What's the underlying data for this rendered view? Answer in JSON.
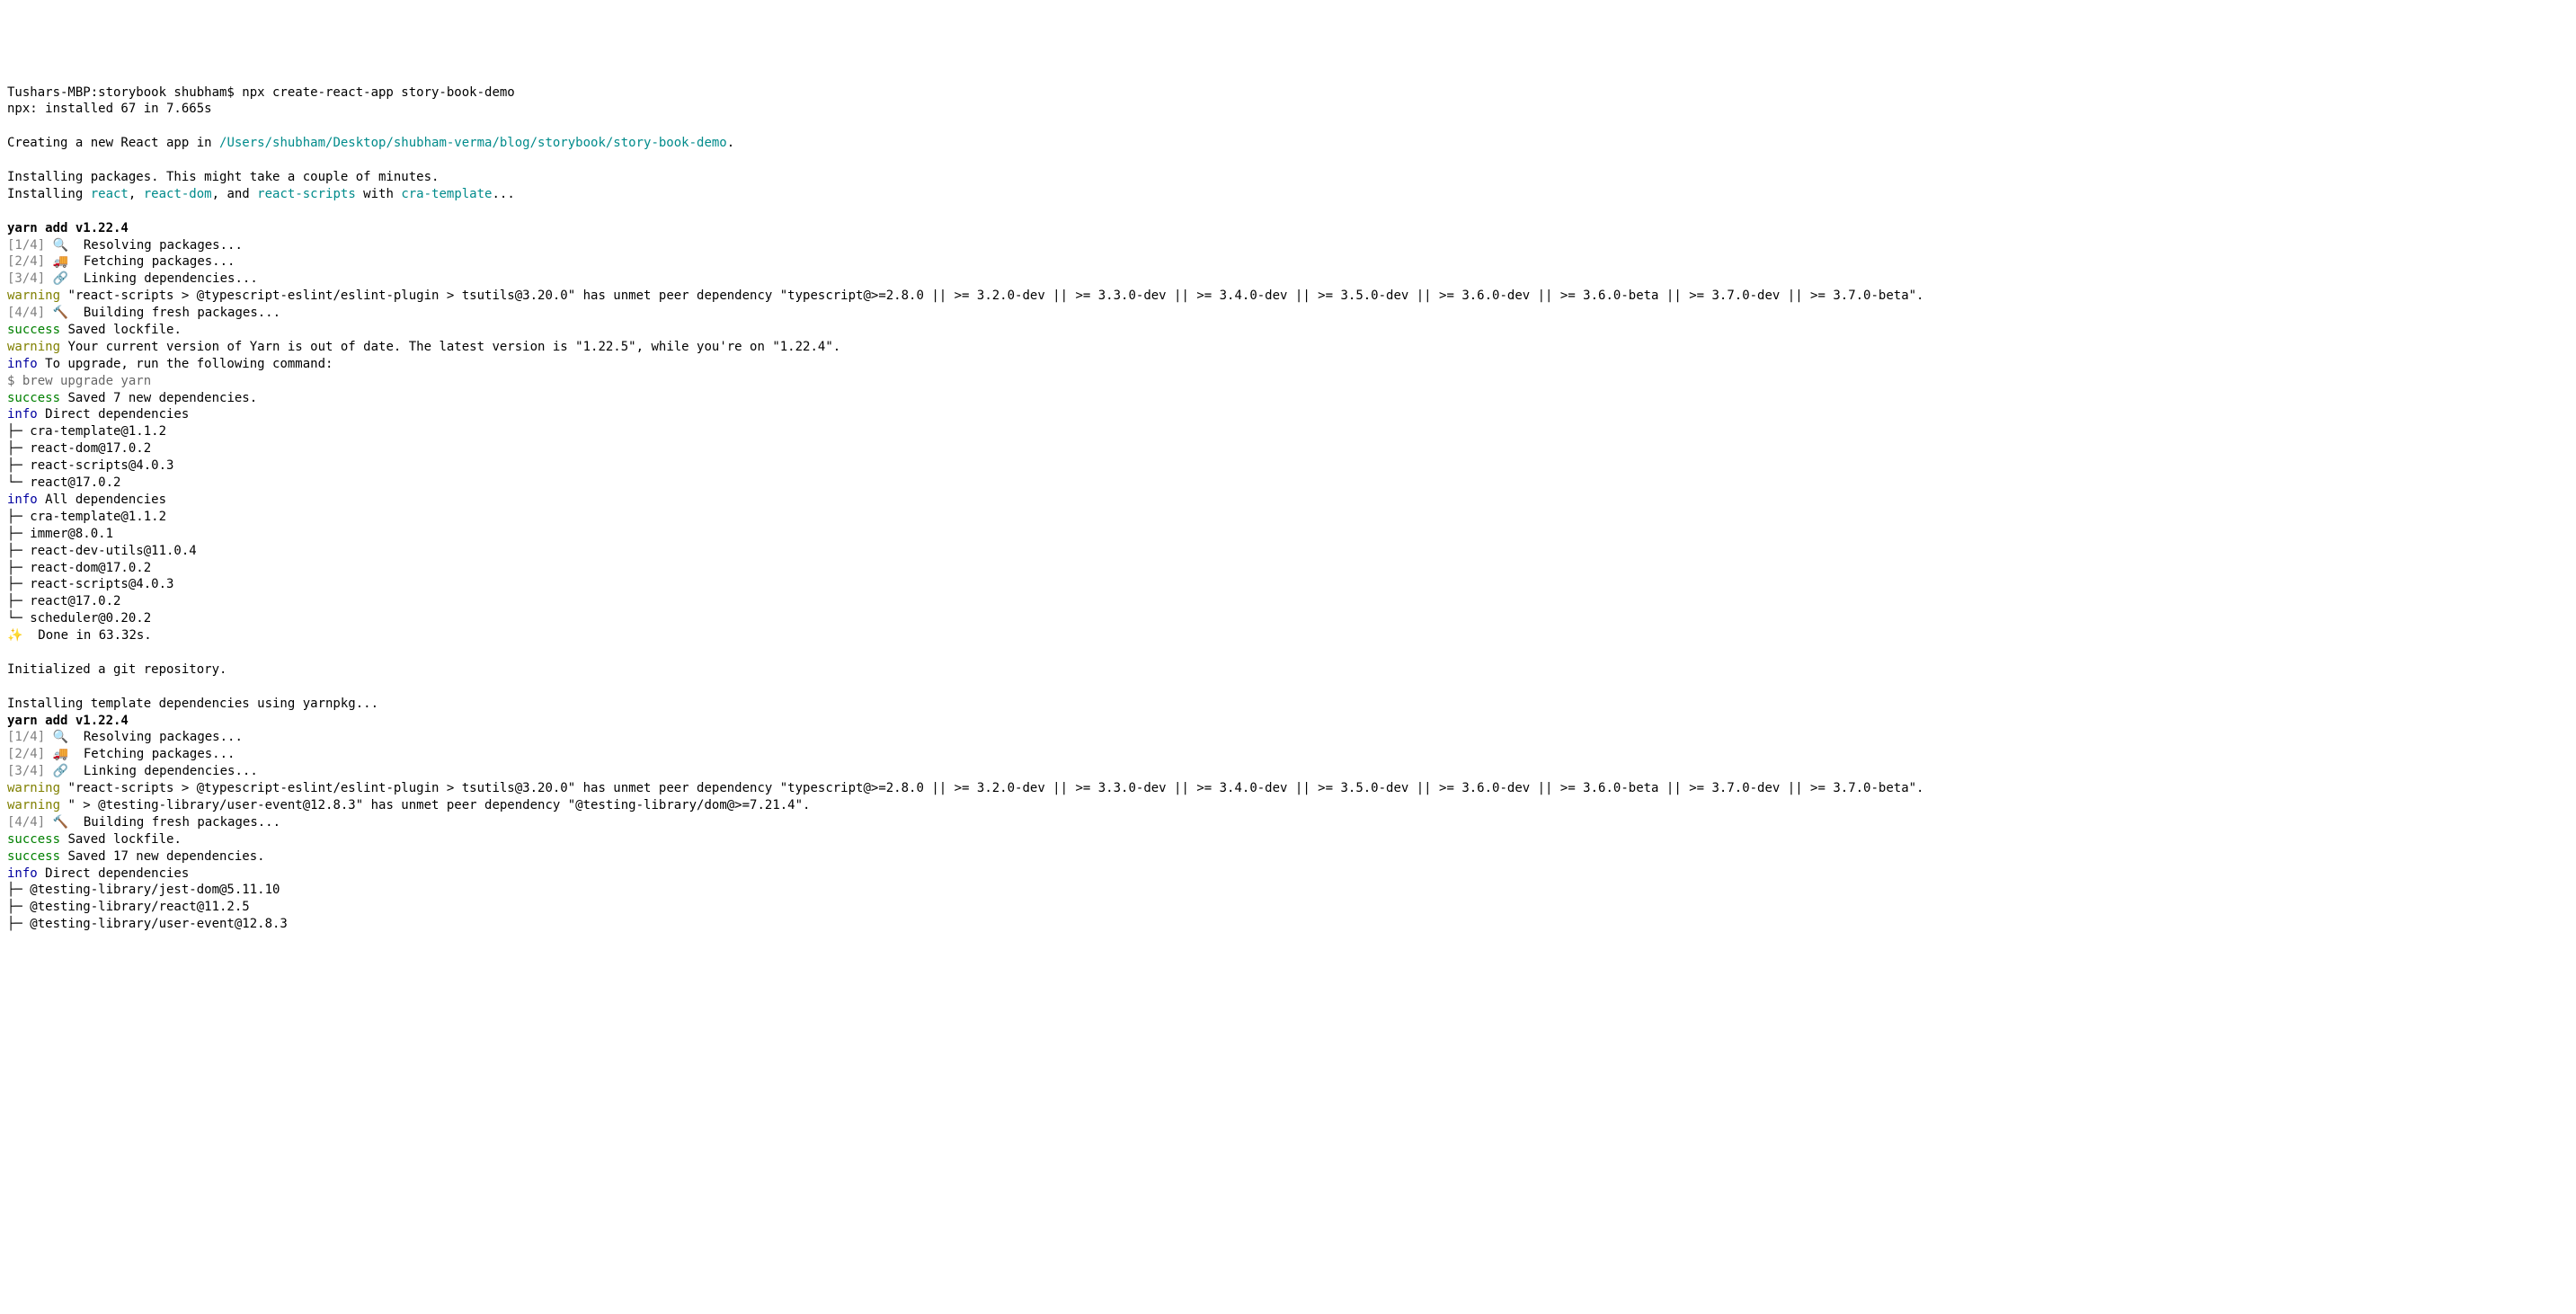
{
  "prompt_prefix": "Tushars-MBP:storybook shubham$ ",
  "prompt_command": "npx create-react-app story-book-demo",
  "npx_line": "npx: installed 67 in 7.665s",
  "creating_prefix": "Creating a new React app in ",
  "creating_path": "/Users/shubham/Desktop/shubham-verma/blog/storybook/story-book-demo",
  "creating_suffix": ".",
  "install_msg1": "Installing packages. This might take a couple of minutes.",
  "install_msg2_pre": "Installing ",
  "pkg_react": "react",
  "sep_comma": ", ",
  "pkg_reactdom": "react-dom",
  "and_text": ", and ",
  "pkg_reactscripts": "react-scripts",
  "with_text": " with ",
  "pkg_cra": "cra-template",
  "ellipsis": "...",
  "yarn_add": "yarn add v1.22.4",
  "step1_tag": "[1/4]",
  "step1_emoji": " 🔍 ",
  "step1_text": " Resolving packages...",
  "step2_tag": "[2/4]",
  "step2_emoji": " 🚚 ",
  "step2_text": " Fetching packages...",
  "step3_tag": "[3/4]",
  "step3_emoji": " 🔗 ",
  "step3_text": " Linking dependencies...",
  "warning_tag": "warning",
  "warn1_text": " \"react-scripts > @typescript-eslint/eslint-plugin > tsutils@3.20.0\" has unmet peer dependency \"typescript@>=2.8.0 || >= 3.2.0-dev || >= 3.3.0-dev || >= 3.4.0-dev || >= 3.5.0-dev || >= 3.6.0-dev || >= 3.6.0-beta || >= 3.7.0-dev || >= 3.7.0-beta\".",
  "step4_tag": "[4/4]",
  "step4_emoji": " 🔨 ",
  "step4_text": " Building fresh packages...",
  "success_tag": "success",
  "success_lock": " Saved lockfile.",
  "warn2_text": " Your current version of Yarn is out of date. The latest version is \"1.22.5\", while you're on \"1.22.4\".",
  "info_tag": "info",
  "info_upgrade": " To upgrade, run the following command:",
  "brew_cmd": "$ brew upgrade yarn",
  "success_saved7": " Saved 7 new dependencies.",
  "info_direct": " Direct dependencies",
  "direct_deps1": [
    "├─ cra-template@1.1.2",
    "├─ react-dom@17.0.2",
    "├─ react-scripts@4.0.3",
    "└─ react@17.0.2"
  ],
  "info_all": " All dependencies",
  "all_deps1": [
    "├─ cra-template@1.1.2",
    "├─ immer@8.0.1",
    "├─ react-dev-utils@11.0.4",
    "├─ react-dom@17.0.2",
    "├─ react-scripts@4.0.3",
    "├─ react@17.0.2",
    "└─ scheduler@0.20.2"
  ],
  "done_emoji": "✨ ",
  "done_text": " Done in 63.32s.",
  "git_init": "Initialized a git repository.",
  "install_template": "Installing template dependencies using yarnpkg...",
  "warn3_text": " \" > @testing-library/user-event@12.8.3\" has unmet peer dependency \"@testing-library/dom@>=7.21.4\".",
  "success_saved17": " Saved 17 new dependencies.",
  "direct_deps2": [
    "├─ @testing-library/jest-dom@5.11.10",
    "├─ @testing-library/react@11.2.5",
    "├─ @testing-library/user-event@12.8.3"
  ]
}
